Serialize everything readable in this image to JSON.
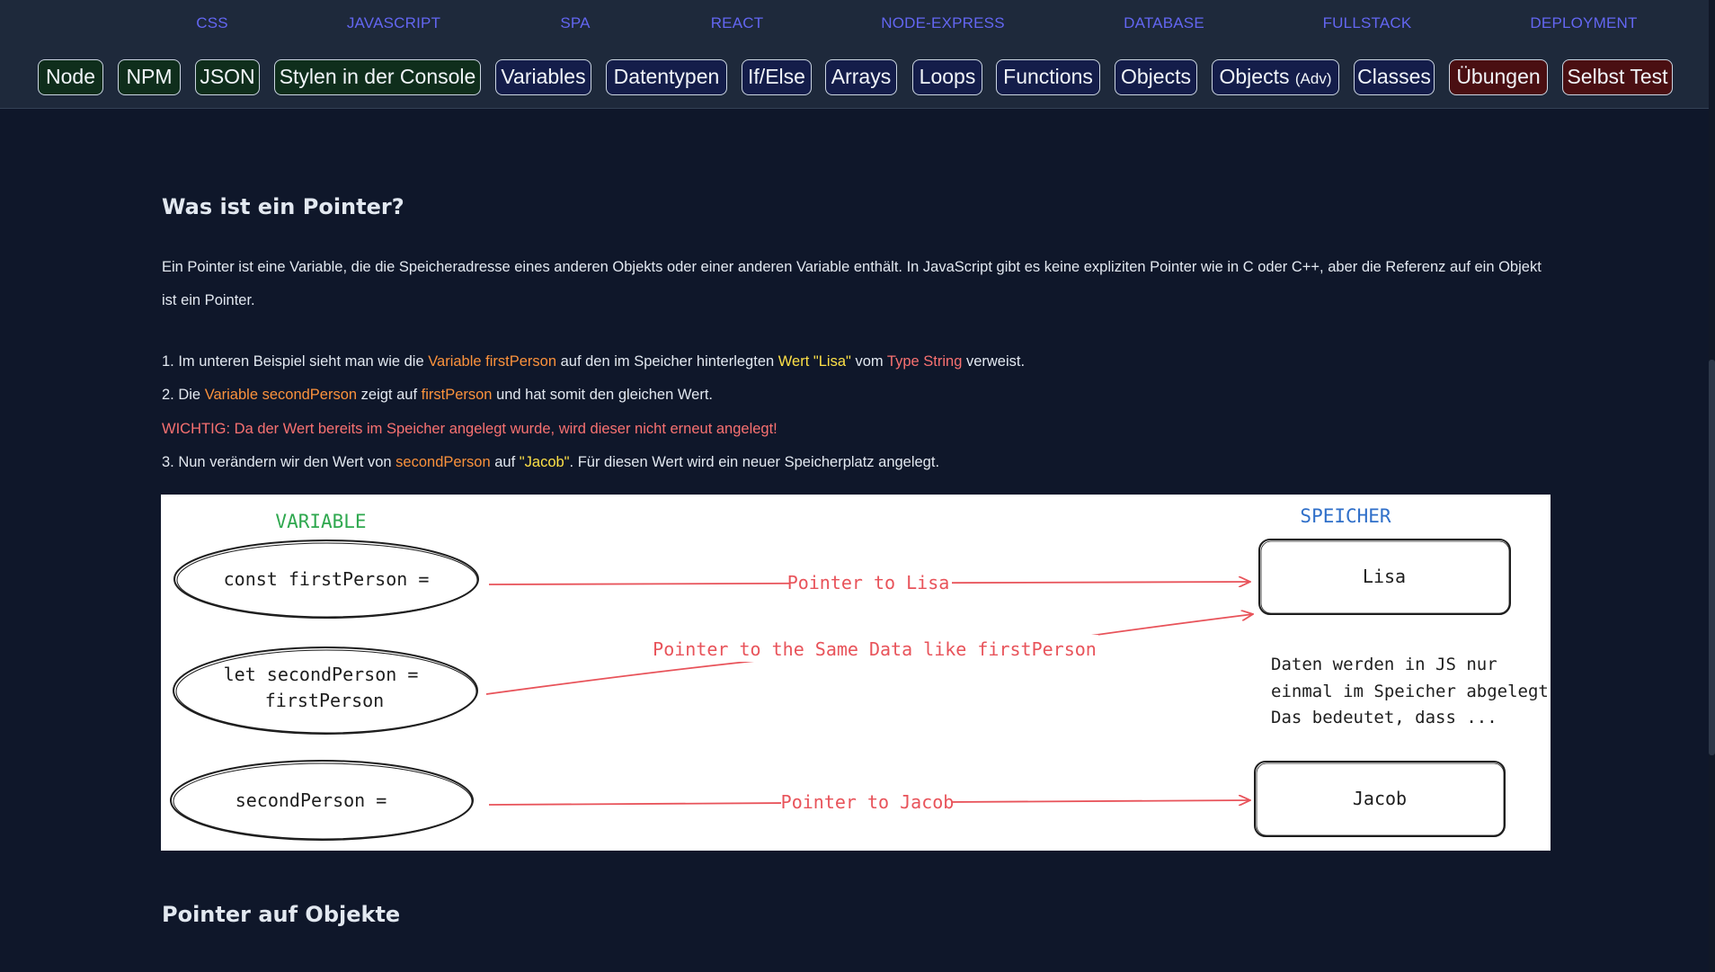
{
  "topnav": [
    "CSS",
    "JAVASCRIPT",
    "SPA",
    "REACT",
    "NODE-EXPRESS",
    "DATABASE",
    "FULLSTACK",
    "DEPLOYMENT"
  ],
  "pills": [
    {
      "label": "Node",
      "style": "green"
    },
    {
      "label": "NPM",
      "style": "green"
    },
    {
      "label": "JSON",
      "style": "green"
    },
    {
      "label": "Stylen in der Console",
      "style": "green"
    },
    {
      "label": "Variables",
      "style": "blue"
    },
    {
      "label": "Datentypen",
      "style": "blue"
    },
    {
      "label": "If/Else",
      "style": "blue"
    },
    {
      "label": "Arrays",
      "style": "blue"
    },
    {
      "label": "Loops",
      "style": "blue"
    },
    {
      "label": "Functions",
      "style": "blue"
    },
    {
      "label": "Objects",
      "style": "blue"
    },
    {
      "label": "Objects",
      "suffix": "(Adv)",
      "style": "blue"
    },
    {
      "label": "Classes",
      "style": "blue"
    },
    {
      "label": "Übungen",
      "style": "red"
    },
    {
      "label": "Selbst Test",
      "style": "red"
    }
  ],
  "section1": {
    "heading": "Was ist ein Pointer?",
    "intro": "Ein Pointer ist eine Variable, die die Speicheradresse eines anderen Objekts oder einer anderen Variable enthält. In JavaScript gibt es keine expliziten Pointer wie in C oder C++, aber die Referenz auf ein Objekt ist ein Pointer.",
    "step1": {
      "a": "1. Im unteren Beispiel sieht man wie die ",
      "b": "Variable firstPerson",
      "c": " auf den im Speicher hinterlegten ",
      "d": "Wert \"Lisa\"",
      "e": " vom ",
      "f": "Type String",
      "g": " verweist."
    },
    "step2": {
      "a": "2. Die ",
      "b": "Variable secondPerson",
      "c": " zeigt auf ",
      "d": "firstPerson",
      "e": " und hat somit den gleichen Wert."
    },
    "warning": "WICHTIG: Da der Wert bereits im Speicher angelegt wurde, wird dieser nicht erneut angelegt!",
    "step3": {
      "a": "3. Nun verändern wir den Wert von ",
      "b": "secondPerson",
      "c": " auf ",
      "d": "\"Jacob\"",
      "e": ". Für diesen Wert wird ein neuer Speicherplatz angelegt."
    }
  },
  "diagram": {
    "variable_header": "VARIABLE",
    "memory_header": "SPEICHER",
    "var1": "const firstPerson =",
    "var2_line1": "let secondPerson =",
    "var2_line2": "firstPerson",
    "var3": "secondPerson =",
    "arrow1": "Pointer to Lisa",
    "arrow2": "Pointer to the Same Data like firstPerson",
    "arrow3": "Pointer to Jacob",
    "mem1": "Lisa",
    "mem2": "Jacob",
    "note_line1": "Daten werden in JS nur",
    "note_line2": "einmal im Speicher abgelegt.",
    "note_line3": "Das bedeutet, dass ...",
    "colors": {
      "green": "#2fa84f",
      "blue": "#2f6fc9",
      "red": "#e8535a",
      "ink": "#1e1e1e"
    }
  },
  "section2": {
    "heading": "Pointer auf Objekte"
  }
}
